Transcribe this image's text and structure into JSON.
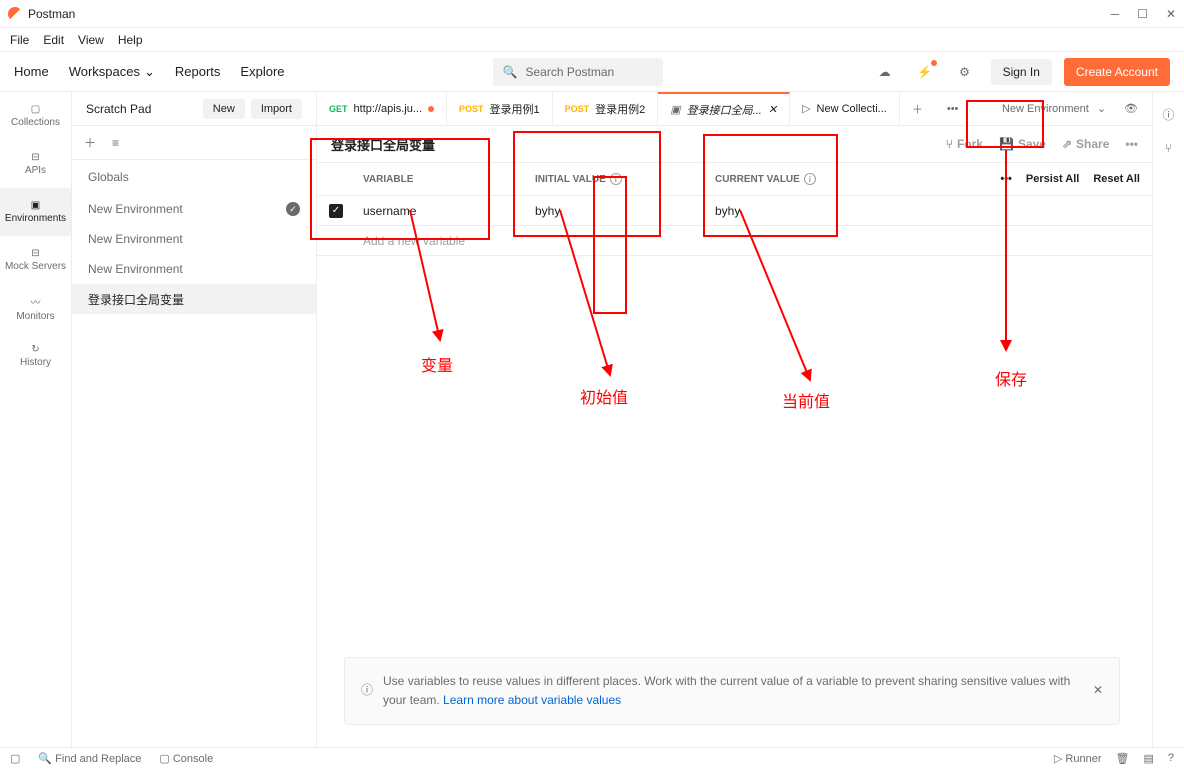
{
  "app": {
    "title": "Postman"
  },
  "menu": {
    "file": "File",
    "edit": "Edit",
    "view": "View",
    "help": "Help"
  },
  "nav": {
    "home": "Home",
    "workspaces": "Workspaces",
    "reports": "Reports",
    "explore": "Explore"
  },
  "search": {
    "placeholder": "Search Postman"
  },
  "auth": {
    "signin": "Sign In",
    "create": "Create Account"
  },
  "rail": {
    "collections": "Collections",
    "apis": "APIs",
    "environments": "Environments",
    "mock": "Mock Servers",
    "monitors": "Monitors",
    "history": "History"
  },
  "sidebar": {
    "title": "Scratch Pad",
    "new": "New",
    "import": "Import",
    "globals": "Globals",
    "items": [
      {
        "label": "New Environment",
        "active": true
      },
      {
        "label": "New Environment"
      },
      {
        "label": "New Environment"
      },
      {
        "label": "登录接口全局变量",
        "selected": true
      }
    ]
  },
  "tabs": [
    {
      "method": "GET",
      "label": "http://apis.ju...",
      "dot": true
    },
    {
      "method": "POST",
      "label": "登录用例1"
    },
    {
      "method": "POST",
      "label": "登录用例2"
    },
    {
      "icon": "env",
      "label": "登录接口全局...",
      "active": true,
      "close": true
    },
    {
      "icon": "play",
      "label": "New Collecti..."
    }
  ],
  "envdrop": "New Environment",
  "env": {
    "title": "登录接口全局变量",
    "fork": "Fork",
    "save": "Save",
    "share": "Share",
    "headers": {
      "variable": "VARIABLE",
      "initial": "INITIAL VALUE",
      "current": "CURRENT VALUE",
      "more": "•••",
      "persist": "Persist All",
      "reset": "Reset All"
    },
    "rows": [
      {
        "checked": true,
        "variable": "username",
        "initial": "byhy",
        "current": "byhy"
      }
    ],
    "add_placeholder": "Add a new variable"
  },
  "banner": {
    "text": "Use variables to reuse values in different places. Work with the current value of a variable to prevent sharing sensitive values with your team. ",
    "link": "Learn more about variable values"
  },
  "footer": {
    "find": "Find and Replace",
    "console": "Console",
    "runner": "Runner"
  },
  "annotations": {
    "variable": "变量",
    "initial": "初始值",
    "current": "当前值",
    "save": "保存"
  }
}
